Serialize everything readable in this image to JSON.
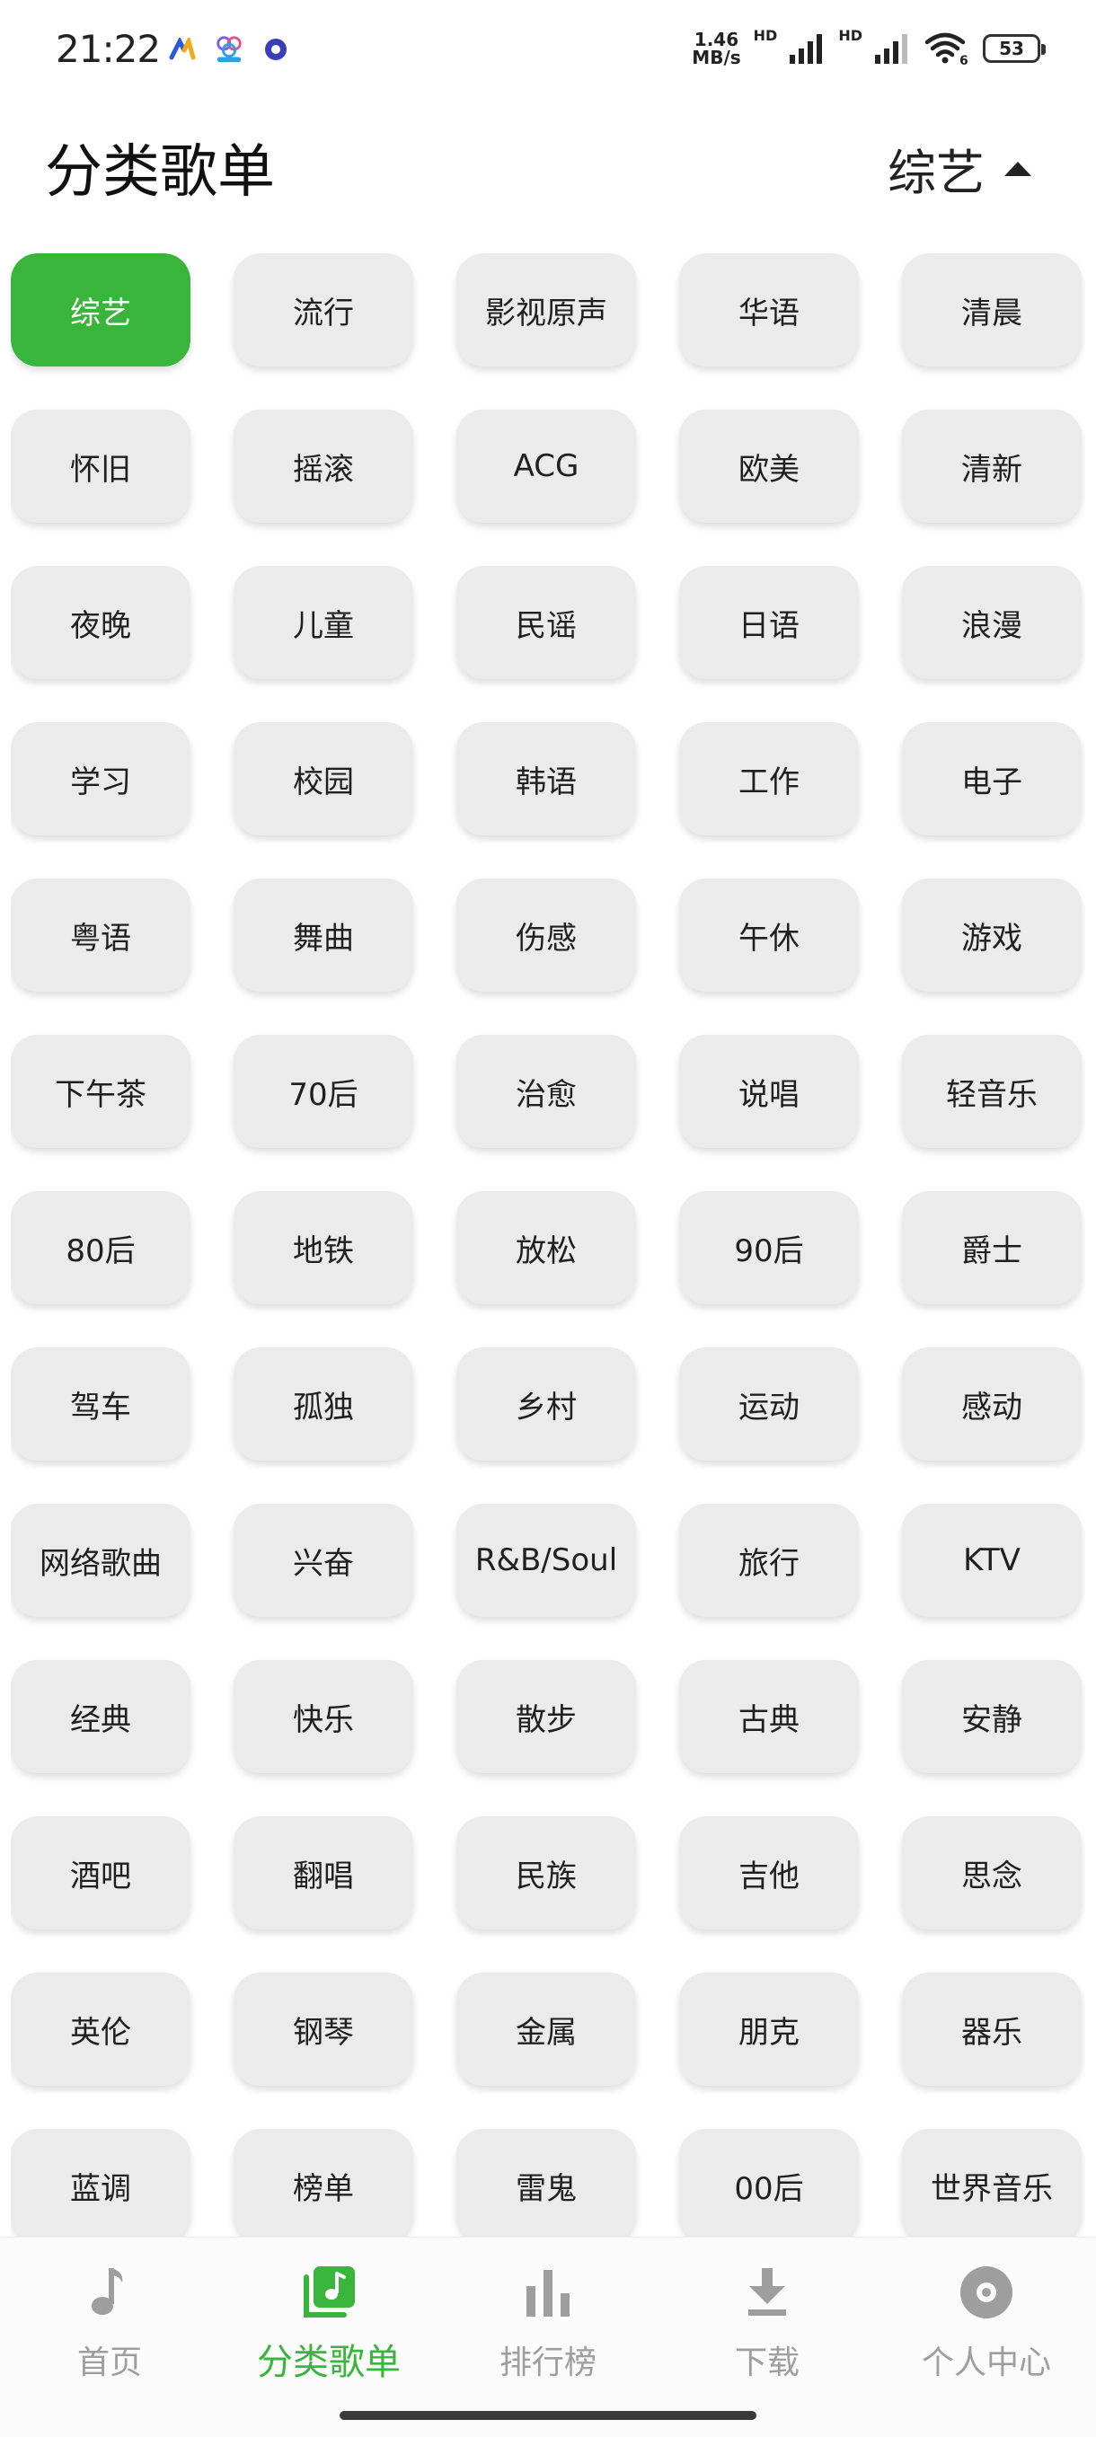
{
  "status_bar": {
    "time": "21:22",
    "net_speed_value": "1.46",
    "net_speed_unit": "MB/s",
    "hd1": "HD",
    "hd2": "HD",
    "wifi_index": "6",
    "battery": "53"
  },
  "header": {
    "title": "分类歌单",
    "current_category": "综艺"
  },
  "categories": [
    "综艺",
    "流行",
    "影视原声",
    "华语",
    "清晨",
    "怀旧",
    "摇滚",
    "ACG",
    "欧美",
    "清新",
    "夜晚",
    "儿童",
    "民谣",
    "日语",
    "浪漫",
    "学习",
    "校园",
    "韩语",
    "工作",
    "电子",
    "粤语",
    "舞曲",
    "伤感",
    "午休",
    "游戏",
    "下午茶",
    "70后",
    "治愈",
    "说唱",
    "轻音乐",
    "80后",
    "地铁",
    "放松",
    "90后",
    "爵士",
    "驾车",
    "孤独",
    "乡村",
    "运动",
    "感动",
    "网络歌曲",
    "兴奋",
    "R&B/Soul",
    "旅行",
    "KTV",
    "经典",
    "快乐",
    "散步",
    "古典",
    "安静",
    "酒吧",
    "翻唱",
    "民族",
    "吉他",
    "思念",
    "英伦",
    "钢琴",
    "金属",
    "朋克",
    "器乐",
    "蓝调",
    "榜单",
    "雷鬼",
    "00后",
    "世界音乐"
  ],
  "selected_category_index": 0,
  "nav": {
    "items": [
      {
        "label": "首页",
        "icon": "music-note-icon"
      },
      {
        "label": "分类歌单",
        "icon": "playlist-icon"
      },
      {
        "label": "排行榜",
        "icon": "bar-chart-icon"
      },
      {
        "label": "下载",
        "icon": "download-icon"
      },
      {
        "label": "个人中心",
        "icon": "disc-icon"
      }
    ],
    "active_index": 1
  },
  "colors": {
    "accent": "#3ab53b",
    "chip_bg": "#ebebeb",
    "nav_inactive": "#9e9e9e"
  }
}
